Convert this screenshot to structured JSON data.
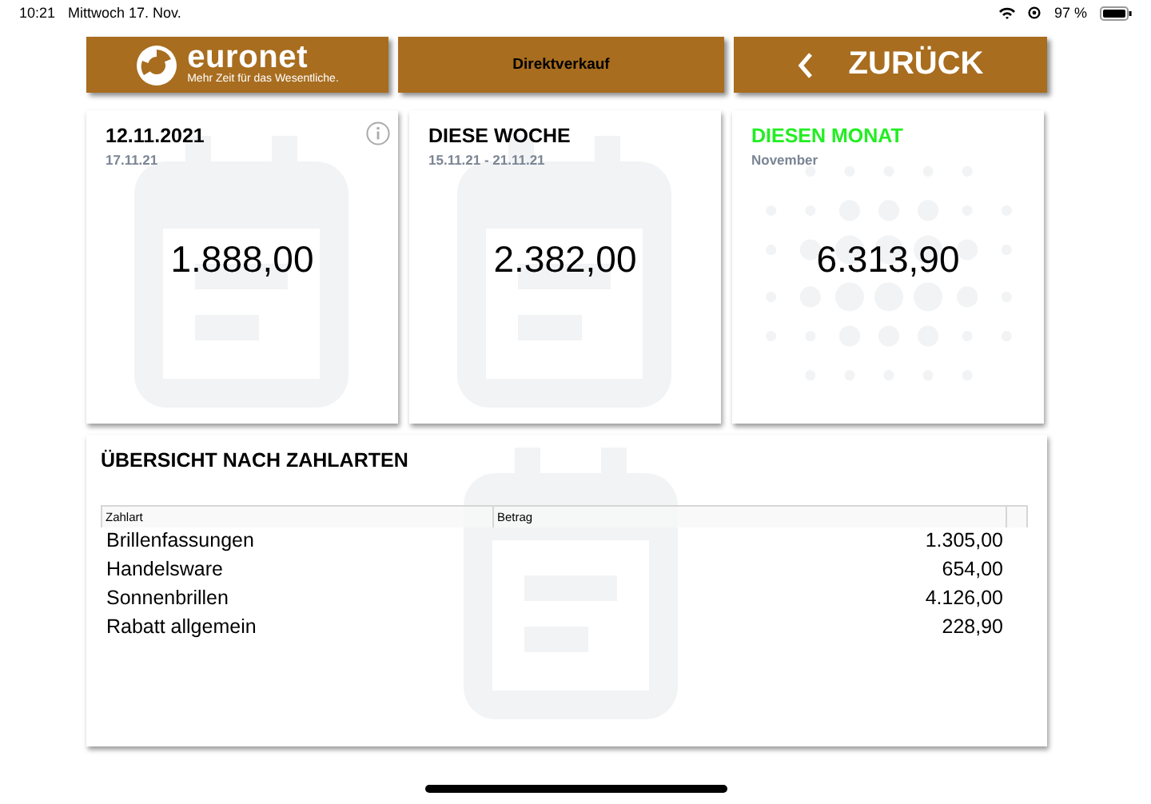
{
  "status_bar": {
    "time": "10:21",
    "date": "Mittwoch 17. Nov.",
    "battery": "97 %"
  },
  "header": {
    "logo_text": "euronet",
    "tagline": "Mehr Zeit für das Wesentliche.",
    "title": "Direktverkauf",
    "back_label": "ZURÜCK"
  },
  "cards": [
    {
      "kind": "calendar",
      "title": "12.11.2021",
      "color": "#000000",
      "subtitle": "17.11.21",
      "value": "1.888,00",
      "info": true
    },
    {
      "kind": "calendar",
      "title": "DIESE WOCHE",
      "color": "#000000",
      "subtitle": "15.11.21 - 21.11.21",
      "value": "2.382,00",
      "info": false
    },
    {
      "kind": "dots",
      "title": "DIESEN MONAT",
      "color": "#22ee22",
      "subtitle": "November",
      "value": "6.313,90",
      "info": false
    }
  ],
  "overview": {
    "title": "ÜBERSICHT NACH ZAHLARTEN",
    "columns": [
      "Zahlart",
      "Betrag"
    ],
    "rows": [
      {
        "name": "Brillenfassungen",
        "amount": "1.305,00"
      },
      {
        "name": "Handelsware",
        "amount": "654,00"
      },
      {
        "name": "Sonnenbrillen",
        "amount": "4.126,00"
      },
      {
        "name": "Rabatt allgemein",
        "amount": "228,90"
      }
    ]
  }
}
